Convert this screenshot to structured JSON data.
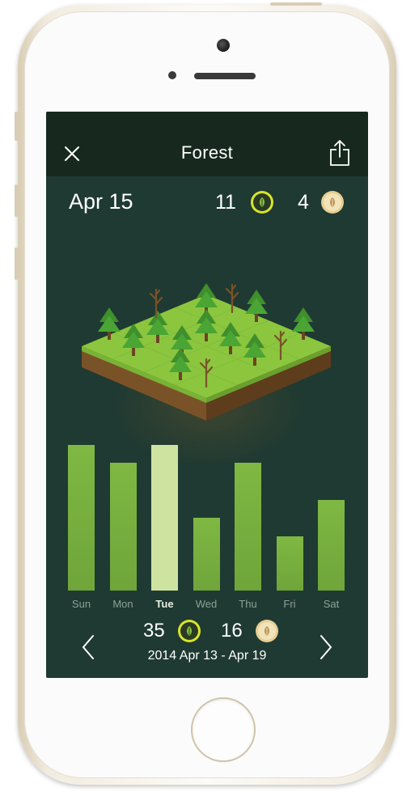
{
  "app": {
    "title": "Forest"
  },
  "day": {
    "date": "Apr 15",
    "healthy_count": "11",
    "withered_count": "4"
  },
  "chart_data": {
    "type": "bar",
    "categories": [
      "Sun",
      "Mon",
      "Tue",
      "Wed",
      "Thu",
      "Fri",
      "Sat"
    ],
    "values": [
      10,
      8.8,
      10,
      5,
      8.8,
      3.7,
      6.2
    ],
    "selected": "Tue",
    "colors": {
      "bar": "#7fb843",
      "selected_bar": "#cfe3a0"
    }
  },
  "week": {
    "healthy_total": "35",
    "withered_total": "16",
    "range": "2014 Apr 13 - Apr 19"
  },
  "icons": {
    "close": "close-icon",
    "share": "share-icon",
    "healthy": "leaf-icon",
    "withered": "withered-leaf-icon",
    "prev": "chevron-left-icon",
    "next": "chevron-right-icon"
  },
  "colors": {
    "screen_bg": "#1f3a32",
    "topbar_bg": "#17291f",
    "grass": "#8cc63f",
    "soil": "#7a5228",
    "leaf_badge": "#d7e52a",
    "wither_badge": "#e6cf94"
  }
}
